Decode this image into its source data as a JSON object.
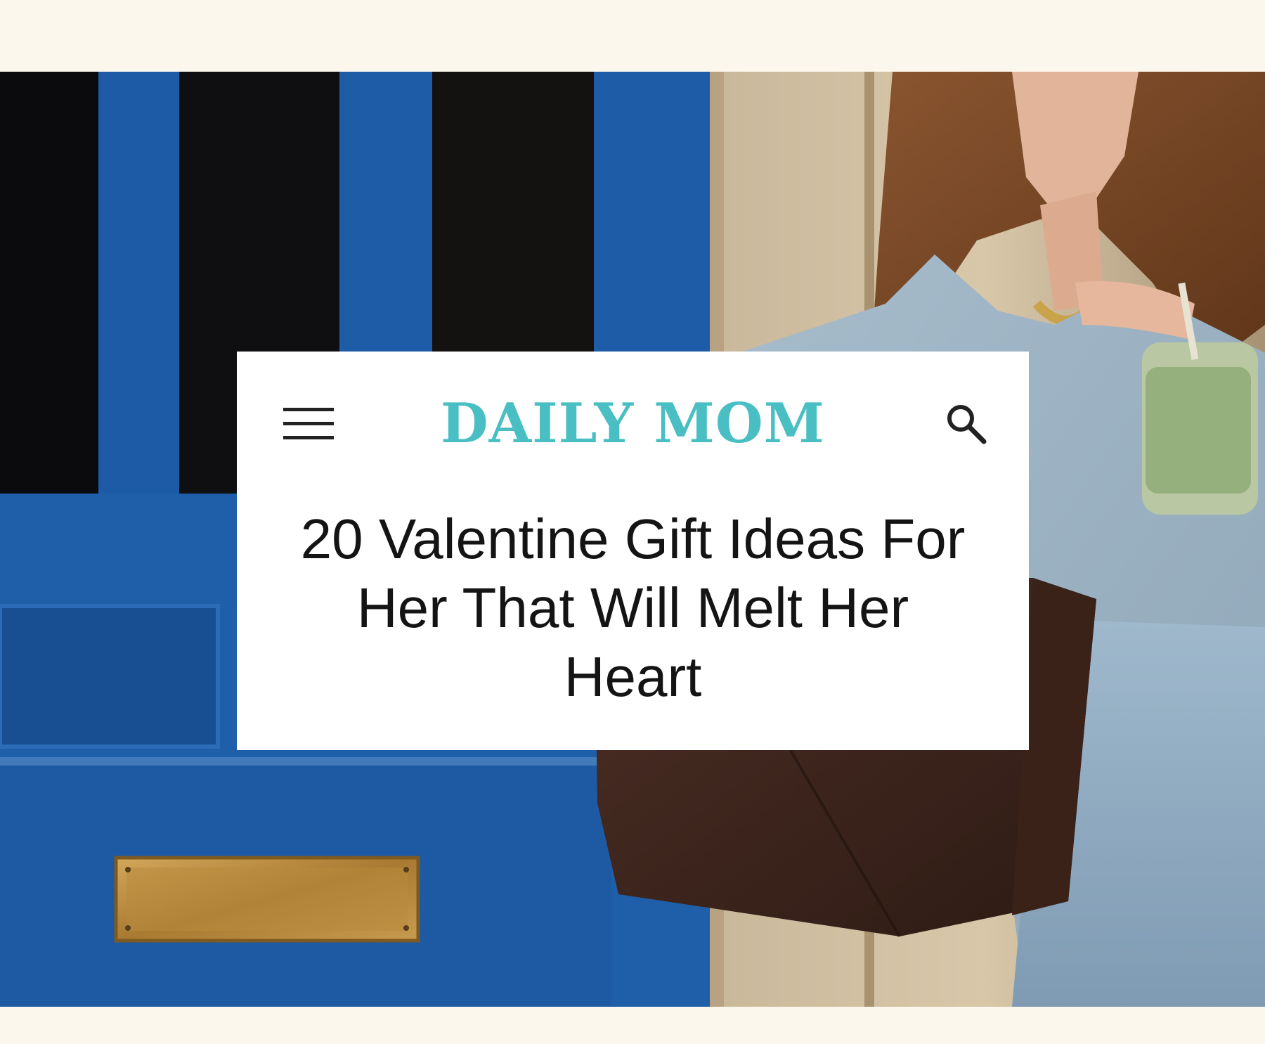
{
  "header": {
    "logo_text": "DAILY MOM",
    "menu_icon": "hamburger-menu-icon",
    "search_icon": "search-icon"
  },
  "article": {
    "title": "20 Valentine Gift Ideas For Her That Will Melt Her Heart"
  },
  "colors": {
    "page_background": "#fbf7ec",
    "logo": "#49bfc4",
    "card_background": "#ffffff",
    "title_text": "#141414"
  }
}
